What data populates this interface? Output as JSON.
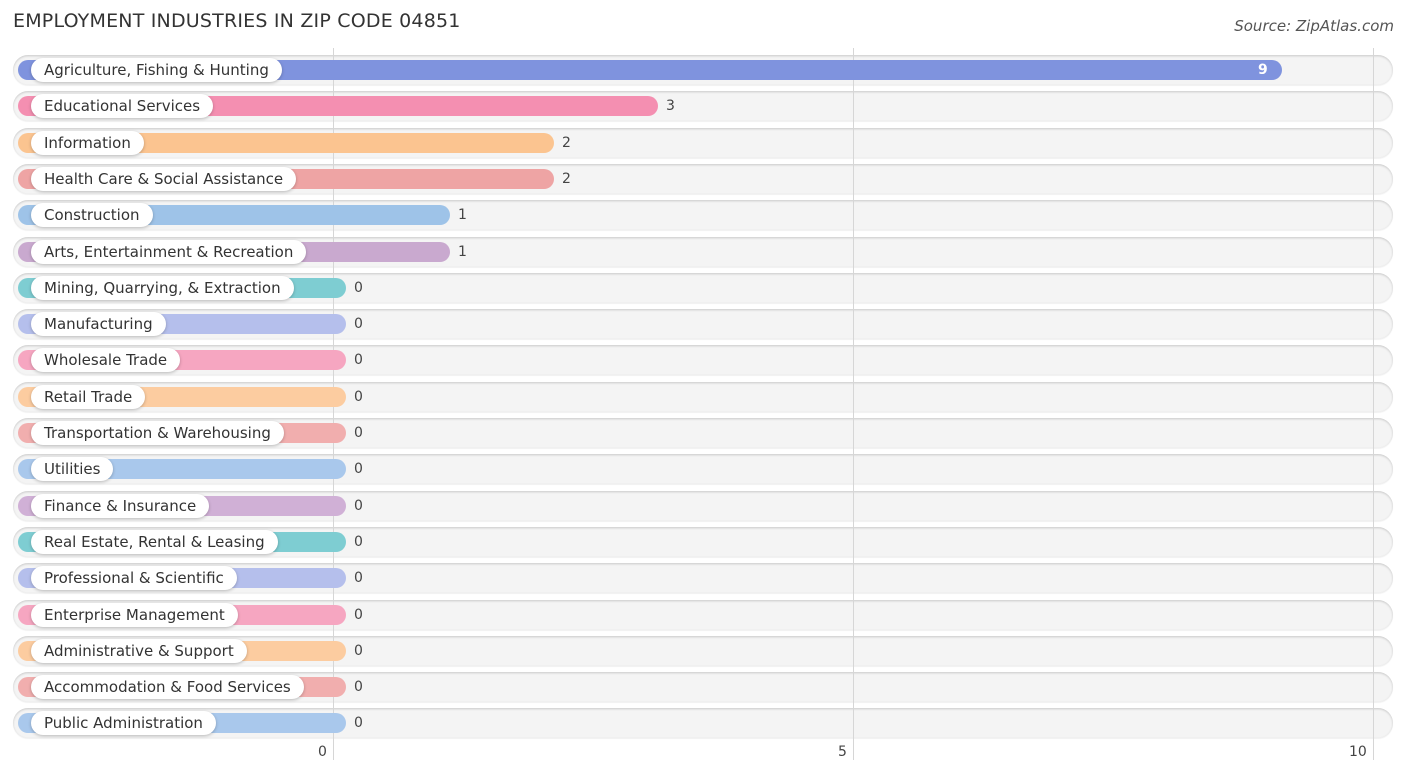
{
  "header": {
    "title": "EMPLOYMENT INDUSTRIES IN ZIP CODE 04851",
    "source": "Source: ZipAtlas.com"
  },
  "chart_data": {
    "type": "bar",
    "orientation": "horizontal",
    "title": "EMPLOYMENT INDUSTRIES IN ZIP CODE 04851",
    "xlabel": "",
    "ylabel": "",
    "xlim": [
      0,
      10
    ],
    "xticks": [
      0,
      5,
      10
    ],
    "xtick_labels": [
      "0",
      "5",
      "10"
    ],
    "grid": true,
    "categories": [
      "Agriculture, Fishing & Hunting",
      "Educational Services",
      "Information",
      "Health Care & Social Assistance",
      "Construction",
      "Arts, Entertainment & Recreation",
      "Mining, Quarrying, & Extraction",
      "Manufacturing",
      "Wholesale Trade",
      "Retail Trade",
      "Transportation & Warehousing",
      "Utilities",
      "Finance & Insurance",
      "Real Estate, Rental & Leasing",
      "Professional & Scientific",
      "Enterprise Management",
      "Administrative & Support",
      "Accommodation & Food Services",
      "Public Administration"
    ],
    "values": [
      9,
      3,
      2,
      2,
      1,
      1,
      0,
      0,
      0,
      0,
      0,
      0,
      0,
      0,
      0,
      0,
      0,
      0,
      0
    ],
    "value_labels": [
      "9",
      "3",
      "2",
      "2",
      "1",
      "1",
      "0",
      "0",
      "0",
      "0",
      "0",
      "0",
      "0",
      "0",
      "0",
      "0",
      "0",
      "0",
      "0"
    ],
    "colors": [
      "#7f93de",
      "#f48fb1",
      "#fbc490",
      "#eea4a4",
      "#9ec3e8",
      "#c9a9cf",
      "#7ecdd2",
      "#b5bfec",
      "#f6a6c1",
      "#fccca0",
      "#f1aeae",
      "#a9c8ec",
      "#d0b0d6",
      "#7ecdd2",
      "#b5bfec",
      "#f6a6c1",
      "#fccca0",
      "#f1aeae",
      "#a9c8ec"
    ]
  }
}
